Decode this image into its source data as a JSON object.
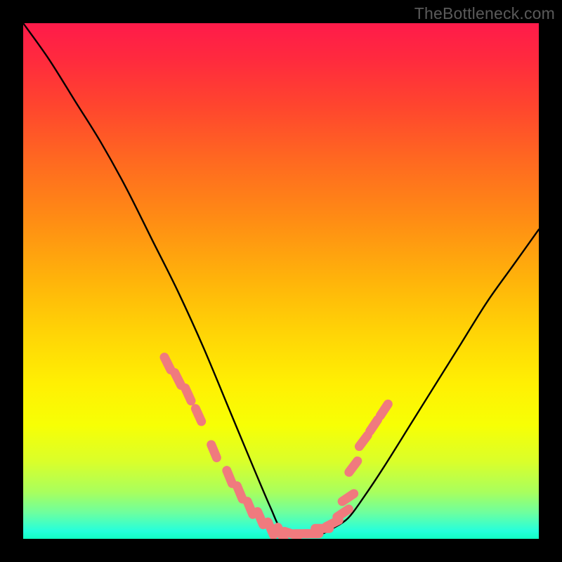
{
  "watermark": "TheBottleneck.com",
  "chart_data": {
    "type": "line",
    "title": "",
    "xlabel": "",
    "ylabel": "",
    "xlim": [
      0,
      100
    ],
    "ylim": [
      0,
      100
    ],
    "series": [
      {
        "name": "curve",
        "x": [
          0,
          5,
          10,
          15,
          20,
          25,
          30,
          35,
          40,
          45,
          48,
          50,
          53,
          56,
          58,
          60,
          63,
          66,
          70,
          75,
          80,
          85,
          90,
          95,
          100
        ],
        "y": [
          100,
          93,
          85,
          77,
          68,
          58,
          48,
          37,
          25,
          13,
          6,
          2,
          1,
          1,
          1,
          2,
          4,
          8,
          14,
          22,
          30,
          38,
          46,
          53,
          60
        ]
      }
    ],
    "markers": {
      "name": "highlight-dots",
      "color": "#f07a7e",
      "x": [
        28,
        30,
        32,
        34,
        37,
        40,
        42,
        44,
        46,
        48,
        50,
        52,
        54,
        56,
        58,
        60,
        62,
        63,
        64,
        66,
        68,
        70
      ],
      "y": [
        34,
        31,
        28,
        24,
        17,
        12,
        9,
        6,
        4,
        2,
        1,
        1,
        1,
        1,
        2,
        3,
        5,
        8,
        14,
        19,
        22,
        25
      ]
    },
    "gradient_stops": [
      {
        "pos": 0.0,
        "color": "#ff1b4a"
      },
      {
        "pos": 0.07,
        "color": "#ff2a3e"
      },
      {
        "pos": 0.16,
        "color": "#ff452e"
      },
      {
        "pos": 0.27,
        "color": "#ff6a20"
      },
      {
        "pos": 0.38,
        "color": "#ff8c14"
      },
      {
        "pos": 0.5,
        "color": "#ffb40a"
      },
      {
        "pos": 0.6,
        "color": "#ffd406"
      },
      {
        "pos": 0.7,
        "color": "#fff003"
      },
      {
        "pos": 0.78,
        "color": "#f7ff05"
      },
      {
        "pos": 0.85,
        "color": "#daff2a"
      },
      {
        "pos": 0.91,
        "color": "#a8ff5e"
      },
      {
        "pos": 0.95,
        "color": "#6cffa0"
      },
      {
        "pos": 0.985,
        "color": "#25ffdc"
      },
      {
        "pos": 1.0,
        "color": "#11ffc4"
      }
    ]
  }
}
